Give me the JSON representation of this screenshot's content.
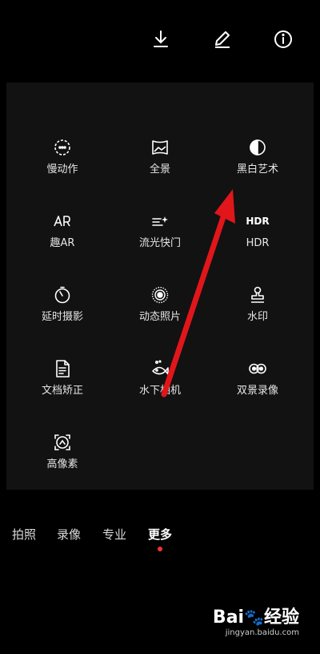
{
  "top_actions": {
    "download_icon": "download-icon",
    "edit_icon": "pencil-icon",
    "info_icon": "info-icon"
  },
  "modes": [
    {
      "label": "慢动作",
      "icon": "slow-motion-icon"
    },
    {
      "label": "全景",
      "icon": "panorama-icon"
    },
    {
      "label": "黑白艺术",
      "icon": "monochrome-icon"
    },
    {
      "label": "趣AR",
      "icon": "ar-icon"
    },
    {
      "label": "流光快门",
      "icon": "light-painting-icon"
    },
    {
      "label": "HDR",
      "icon": "hdr-icon",
      "glyph": "HDR"
    },
    {
      "label": "延时摄影",
      "icon": "time-lapse-icon"
    },
    {
      "label": "动态照片",
      "icon": "moving-picture-icon"
    },
    {
      "label": "水印",
      "icon": "watermark-stamp-icon"
    },
    {
      "label": "文档矫正",
      "icon": "document-icon"
    },
    {
      "label": "水下相机",
      "icon": "underwater-icon"
    },
    {
      "label": "双景录像",
      "icon": "dual-view-icon"
    },
    {
      "label": "高像素",
      "icon": "high-resolution-icon"
    }
  ],
  "tabs": [
    {
      "label": "拍照",
      "active": false
    },
    {
      "label": "录像",
      "active": false
    },
    {
      "label": "专业",
      "active": false
    },
    {
      "label": "更多",
      "active": true
    }
  ],
  "watermark": {
    "logo": "Bai",
    "logo_suffix": "经验",
    "url": "jingyan.baidu.com"
  },
  "colors": {
    "background": "#000000",
    "panel": "#121212",
    "accent_dot": "#e33333",
    "annotation_arrow": "#e0161b"
  }
}
